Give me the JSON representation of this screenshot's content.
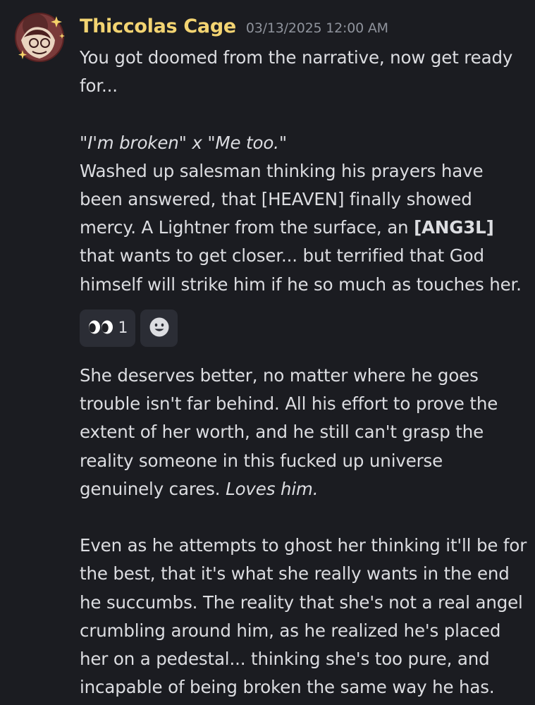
{
  "message": {
    "author": "Thiccolas Cage",
    "timestamp": "03/13/2025 12:00 AM",
    "colors": {
      "username": "#f3d472",
      "timestamp": "#8f939c",
      "text": "#dcdde1",
      "background": "#1b1c21",
      "reaction_bg": "#2b2d35"
    },
    "body_part1": {
      "line1": "You got doomed from the narrative, now get ready for...",
      "quote": "\"I'm broken\" x \"Me too.\"",
      "para_a": "Washed up salesman thinking his prayers have been answered, that [HEAVEN] finally showed mercy. A Lightner from the surface, an ",
      "para_bold": "[ANG3L]",
      "para_b": " that wants to get closer... but terrified that God himself will strike him if he so much as touches her."
    },
    "reactions": [
      {
        "emoji": "eyes-icon",
        "count": "1"
      },
      {
        "emoji": "add-reaction-icon"
      }
    ],
    "body_part2": {
      "para1_a": "She deserves better, no matter where he goes trouble isn't far behind. All his effort to prove the extent of her worth, and he still can't grasp the reality someone in this fucked up universe genuinely cares. ",
      "para1_italic": "Loves him.",
      "para2": "Even as he attempts to ghost her thinking it'll be for the best, that it's what she really wants in the end he succumbs. The reality that she's not a real angel crumbling around him, as he realized he's placed her on a pedestal... thinking she's too pure, and incapable of being broken the same way he has."
    }
  }
}
